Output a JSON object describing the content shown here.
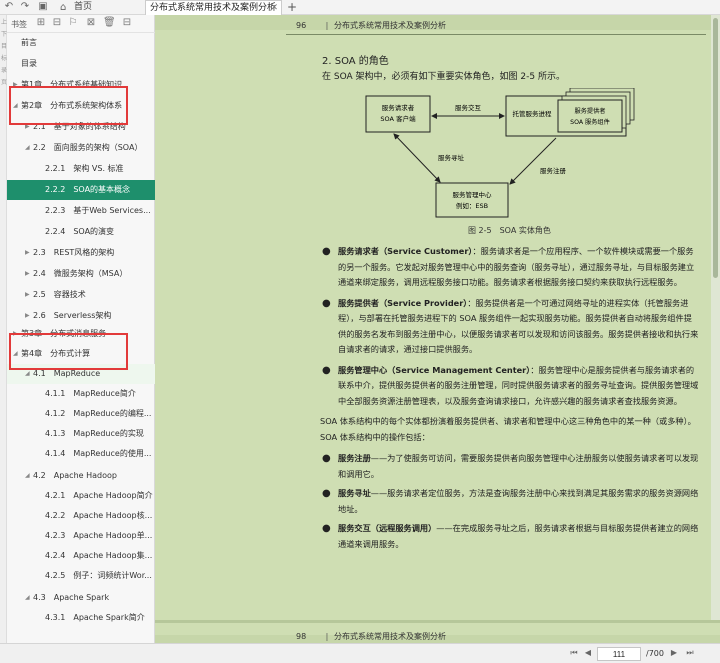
{
  "topbar": {
    "home_label": "首页",
    "tab_title": "分布式系统常用技术及案例分析",
    "new_tab": "+"
  },
  "strip": [
    "上",
    "下",
    "目",
    "标",
    "录",
    "页"
  ],
  "sidebar": {
    "header_label": "书签",
    "items": [
      {
        "text": "前言",
        "arrow": ""
      },
      {
        "text": "目录",
        "arrow": ""
      },
      {
        "text": "第1章　分布式系统基础知识",
        "arrow": "▶"
      },
      {
        "text": "第2章　分布式系统架构体系",
        "arrow": "◢"
      },
      {
        "text": "2.1　基于对象的体系结构",
        "arrow": "▶"
      },
      {
        "text": "2.2　面向服务的架构（SOA）",
        "arrow": "◢"
      },
      {
        "text": "2.2.1　架构 VS. 标准",
        "arrow": ""
      },
      {
        "text": "2.2.2　SOA的基本概念",
        "arrow": ""
      },
      {
        "text": "2.2.3　基于Web Services...",
        "arrow": ""
      },
      {
        "text": "2.2.4　SOA的演变",
        "arrow": ""
      },
      {
        "text": "2.3　REST风格的架构",
        "arrow": "▶"
      },
      {
        "text": "2.4　微服务架构（MSA）",
        "arrow": "▶"
      },
      {
        "text": "2.5　容器技术",
        "arrow": "▶"
      },
      {
        "text": "2.6　Serverless架构",
        "arrow": "▶"
      },
      {
        "text": "第3章　分布式消息服务",
        "arrow": "▶"
      },
      {
        "text": "第4章　分布式计算",
        "arrow": "◢"
      },
      {
        "text": "4.1　MapReduce",
        "arrow": "◢"
      },
      {
        "text": "4.1.1　MapReduce简介",
        "arrow": ""
      },
      {
        "text": "4.1.2　MapReduce的编程...",
        "arrow": ""
      },
      {
        "text": "4.1.3　MapReduce的实现",
        "arrow": ""
      },
      {
        "text": "4.1.4　MapReduce的使用...",
        "arrow": ""
      },
      {
        "text": "4.2　Apache Hadoop",
        "arrow": "◢"
      },
      {
        "text": "4.2.1　Apache Hadoop简介",
        "arrow": ""
      },
      {
        "text": "4.2.2　Apache Hadoop核...",
        "arrow": ""
      },
      {
        "text": "4.2.3　Apache Hadoop单...",
        "arrow": ""
      },
      {
        "text": "4.2.4　Apache Hadoop集...",
        "arrow": ""
      },
      {
        "text": "4.2.5　例子：词频统计Wor...",
        "arrow": ""
      },
      {
        "text": "4.3　Apache Spark",
        "arrow": "◢"
      },
      {
        "text": "4.3.1　Apache Spark简介",
        "arrow": ""
      }
    ]
  },
  "page": {
    "header_num": "96",
    "header_sep": "|",
    "header_title": "分布式系统常用技术及案例分析",
    "section_title": "2. SOA 的角色",
    "intro": "在 SOA 架构中，必须有如下重要实体角色，如图 2-5 所示。",
    "figure": {
      "requester_line1": "服务请求者",
      "requester_line2": "SOA 客户端",
      "provider_line1": "托管服务进程",
      "component_line1": "服务提供者",
      "component_line2": "SOA 服务组件",
      "manager_line1": "服务管理中心",
      "manager_line2": "例如：ESB",
      "edge_interact": "服务交互",
      "edge_find": "服务寻址",
      "edge_register": "服务注册",
      "caption": "图 2-5　SOA 实体角色"
    },
    "bullet_requester_term": "服务请求者（Service Customer）",
    "bullet_requester_text": "：服务请求者是一个应用程序、一个软件模块或需要一个服务的另一个服务。它发起对服务管理中心中的服务查询（服务寻址），通过服务寻址，与目标服务建立通道来绑定服务，调用远程服务接口功能。服务请求者根据服务接口契约来获取执行远程服务。",
    "bullet_provider_term": "服务提供者（Service Provider）",
    "bullet_provider_text": "：服务提供者是一个可通过网络寻址的进程实体（托管服务进程），与部署在托管服务进程下的 SOA 服务组件一起实现服务功能。服务提供者自动将服务组件提供的服务名发布到服务注册中心，以便服务请求者可以发现和访问该服务。服务提供者接收和执行来自请求者的请求，通过接口提供服务。",
    "bullet_center_term": "服务管理中心（Service Management Center）",
    "bullet_center_text": "：服务管理中心是服务提供者与服务请求者的联系中介，提供服务提供者的服务注册管理，同时提供服务请求者的服务寻址查询。提供服务管理域中全部服务资源注册管理表，以及服务查询请求接口，允许感兴趣的服务请求者查找服务资源。",
    "para": "SOA 体系结构中的每个实体都扮演着服务提供者、请求者和管理中心这三种角色中的某一种（或多种）。SOA 体系结构中的操作包括：",
    "op_register_term": "服务注册",
    "op_register_text": "——为了使服务可访问，需要服务提供者向服务管理中心注册服务以使服务请求者可以发现和调用它。",
    "op_find_term": "服务寻址",
    "op_find_text": "——服务请求者定位服务，方法是查询服务注册中心来找到满足其服务需求的服务资源网络地址。",
    "op_interact_term": "服务交互（远程服务调用）",
    "op_interact_text": "——在完成服务寻址之后，服务请求者根据与目标服务提供者建立的网络通道来调用服务。",
    "footer_num": "98",
    "footer_sep": "|",
    "footer_title": "分布式系统常用技术及案例分析"
  },
  "bottombar": {
    "current_page": "111",
    "total_pages": "/700"
  },
  "colors": {
    "active_bg": "#1e8f6c",
    "page_bg": "#cfdeb3",
    "highlight_red": "#e23a3a"
  }
}
